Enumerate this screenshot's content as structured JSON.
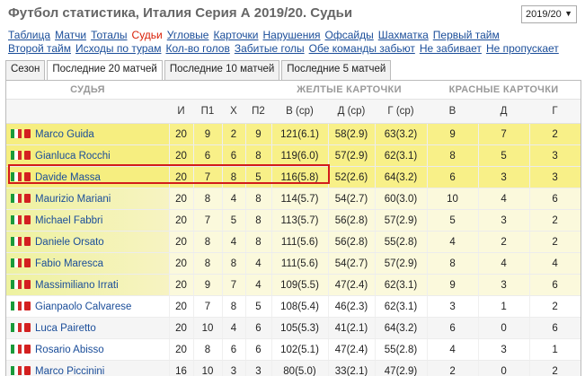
{
  "page": {
    "title": "Футбол статистика, Италия Серия А 2019/20. Судьи",
    "season_selected": "2019/20"
  },
  "nav": {
    "row1": [
      "Таблица",
      "Матчи",
      "Тоталы",
      "Судьи",
      "Угловые",
      "Карточки",
      "Нарушения",
      "Офсайды",
      "Шахматка",
      "Первый тайм"
    ],
    "row2": [
      "Второй тайм",
      "Исходы по турам",
      "Кол-во голов",
      "Забитые голы",
      "Обе команды забьют",
      "Не забивает",
      "Не пропускает"
    ],
    "active": "Судьи"
  },
  "tabs": [
    "Сезон",
    "Последние 20 матчей",
    "Последние 10 матчей",
    "Последние 5 матчей"
  ],
  "active_tab": "Последние 20 матчей",
  "table": {
    "groups": {
      "referee": "СУДЬЯ",
      "yellow": "ЖЕЛТЫЕ КАРТОЧКИ",
      "red": "КРАСНЫЕ КАРТОЧКИ"
    },
    "columns": [
      "И",
      "П1",
      "Х",
      "П2",
      "В (ср)",
      "Д (ср)",
      "Г (ср)",
      "В",
      "Д",
      "Г"
    ],
    "rows": [
      {
        "name": "Marco Guida",
        "i": "20",
        "p1": "9",
        "x": "2",
        "p2": "9",
        "yv": "121(6.1)",
        "yd": "58(2.9)",
        "yg": "63(3.2)",
        "rv": "9",
        "rd": "7",
        "rg": "2"
      },
      {
        "name": "Gianluca Rocchi",
        "i": "20",
        "p1": "6",
        "x": "6",
        "p2": "8",
        "yv": "119(6.0)",
        "yd": "57(2.9)",
        "yg": "62(3.1)",
        "rv": "8",
        "rd": "5",
        "rg": "3"
      },
      {
        "name": "Davide Massa",
        "i": "20",
        "p1": "7",
        "x": "8",
        "p2": "5",
        "yv": "116(5.8)",
        "yd": "52(2.6)",
        "yg": "64(3.2)",
        "rv": "6",
        "rd": "3",
        "rg": "3"
      },
      {
        "name": "Maurizio Mariani",
        "i": "20",
        "p1": "8",
        "x": "4",
        "p2": "8",
        "yv": "114(5.7)",
        "yd": "54(2.7)",
        "yg": "60(3.0)",
        "rv": "10",
        "rd": "4",
        "rg": "6"
      },
      {
        "name": "Michael Fabbri",
        "i": "20",
        "p1": "7",
        "x": "5",
        "p2": "8",
        "yv": "113(5.7)",
        "yd": "56(2.8)",
        "yg": "57(2.9)",
        "rv": "5",
        "rd": "3",
        "rg": "2"
      },
      {
        "name": "Daniele Orsato",
        "i": "20",
        "p1": "8",
        "x": "4",
        "p2": "8",
        "yv": "111(5.6)",
        "yd": "56(2.8)",
        "yg": "55(2.8)",
        "rv": "4",
        "rd": "2",
        "rg": "2"
      },
      {
        "name": "Fabio Maresca",
        "i": "20",
        "p1": "8",
        "x": "8",
        "p2": "4",
        "yv": "111(5.6)",
        "yd": "54(2.7)",
        "yg": "57(2.9)",
        "rv": "8",
        "rd": "4",
        "rg": "4"
      },
      {
        "name": "Massimiliano Irrati",
        "i": "20",
        "p1": "9",
        "x": "7",
        "p2": "4",
        "yv": "109(5.5)",
        "yd": "47(2.4)",
        "yg": "62(3.1)",
        "rv": "9",
        "rd": "3",
        "rg": "6"
      },
      {
        "name": "Gianpaolo Calvarese",
        "i": "20",
        "p1": "7",
        "x": "8",
        "p2": "5",
        "yv": "108(5.4)",
        "yd": "46(2.3)",
        "yg": "62(3.1)",
        "rv": "3",
        "rd": "1",
        "rg": "2"
      },
      {
        "name": "Luca Pairetto",
        "i": "20",
        "p1": "10",
        "x": "4",
        "p2": "6",
        "yv": "105(5.3)",
        "yd": "41(2.1)",
        "yg": "64(3.2)",
        "rv": "6",
        "rd": "0",
        "rg": "6"
      },
      {
        "name": "Rosario Abisso",
        "i": "20",
        "p1": "8",
        "x": "6",
        "p2": "6",
        "yv": "102(5.1)",
        "yd": "47(2.4)",
        "yg": "55(2.8)",
        "rv": "4",
        "rd": "3",
        "rg": "1"
      },
      {
        "name": "Marco Piccinini",
        "i": "16",
        "p1": "10",
        "x": "3",
        "p2": "3",
        "yv": "80(5.0)",
        "yd": "33(2.1)",
        "yg": "47(2.9)",
        "rv": "2",
        "rd": "0",
        "rg": "2"
      }
    ]
  },
  "colors": {
    "link": "#1a4d99",
    "active": "#d81e05",
    "yellow_row": "#f8f088",
    "highlight": "#d21b1b"
  },
  "icons": {
    "flag": "italy-flag-icon",
    "card": "red-card-icon",
    "dropdown": "chevron-down-icon"
  }
}
